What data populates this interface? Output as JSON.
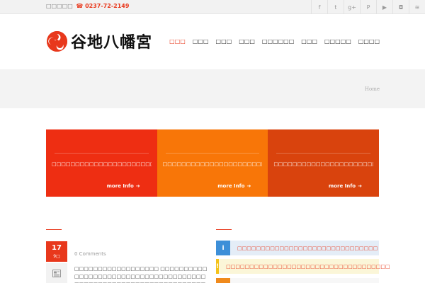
{
  "topbar": {
    "contact_label": "□□□□□",
    "phone_icon": "☎",
    "phone": "0237-72-2149",
    "social": [
      {
        "icon": "facebook-icon",
        "glyph": "f"
      },
      {
        "icon": "twitter-icon",
        "glyph": "t"
      },
      {
        "icon": "google-plus-icon",
        "glyph": "g+"
      },
      {
        "icon": "pinterest-icon",
        "glyph": "P"
      },
      {
        "icon": "youtube-icon",
        "glyph": "▶"
      },
      {
        "icon": "instagram-icon",
        "glyph": "◘"
      },
      {
        "icon": "rss-icon",
        "glyph": "≋"
      }
    ]
  },
  "header": {
    "logo_text": "谷地八幡宮",
    "nav": [
      "□□□",
      "□□□",
      "□□□",
      "□□□",
      "□□□□□□",
      "□□□",
      "□□□□□",
      "□□□□"
    ]
  },
  "breadcrumb": {
    "home": "Home"
  },
  "features": [
    {
      "text": "□□□□□□□□□□□□□□□□□□□□□□□□□□□□□□□□",
      "more": "more Info",
      "color": "#ee2e12"
    },
    {
      "text": "□□□□□□□□□□□□□□□□□□□□□□□□□□□□□□□□",
      "more": "more Info",
      "color": "#f87608"
    },
    {
      "text": "□□□□□□□□□□□□□□□□□□□□□□□□□□□□□□□□□",
      "more": "more Info",
      "color": "#d9430d"
    }
  ],
  "post": {
    "day": "17",
    "month": "9□",
    "comments": "0 Comments",
    "text": "□□□□□□□□□□□□□□□□□□ □□□□□□□□□□□□□□□□□□□□□□□□□□□□□□□□□□□□□□□□□□□□□□□□□□□□□□□□□□□□□□□□□□□□□□□□□□□□□□□□□□□□□□□□□□□□"
  },
  "alerts": [
    {
      "icon": "i",
      "text": "□□□□□□□□□□□□□□□□□□□□□□□□□□□□□□"
    },
    {
      "icon": "!",
      "text": "□□□□□□□□□□□□□□□□□□□□□□□□□□□□□□□□□□□"
    },
    {
      "icon": "",
      "text": ""
    }
  ],
  "colors": {
    "accent": "#e8381c"
  }
}
